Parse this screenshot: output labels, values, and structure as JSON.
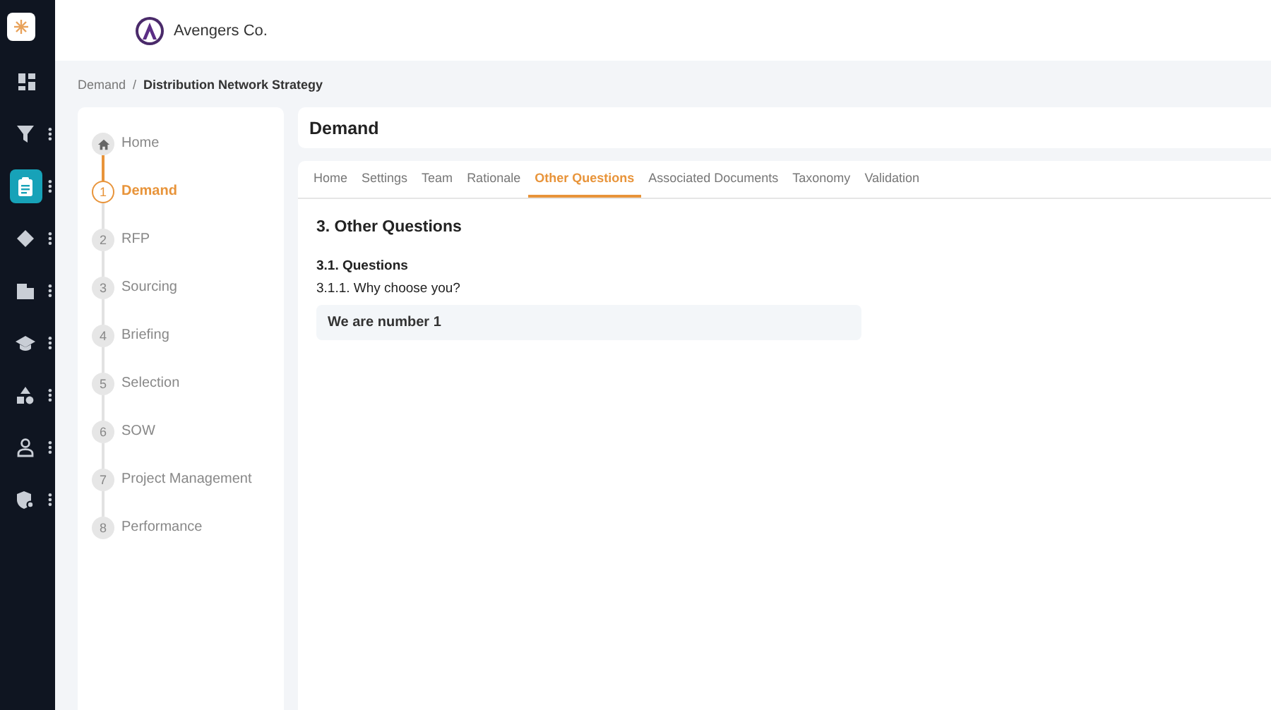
{
  "sidebar": {
    "items": [
      {
        "selected": false,
        "has_menu": false
      },
      {
        "selected": false,
        "has_menu": true
      },
      {
        "selected": true,
        "has_menu": true
      },
      {
        "selected": false,
        "has_menu": true
      },
      {
        "selected": false,
        "has_menu": true
      },
      {
        "selected": false,
        "has_menu": true
      },
      {
        "selected": false,
        "has_menu": true
      },
      {
        "selected": false,
        "has_menu": true
      },
      {
        "selected": false,
        "has_menu": true
      }
    ]
  },
  "header": {
    "company": "Avengers Co."
  },
  "breadcrumb": {
    "parent": "Demand",
    "separator": "/",
    "current": "Distribution Network Strategy"
  },
  "steps": [
    {
      "kind": "home",
      "label": "Home",
      "selected": false
    },
    {
      "kind": "numbered",
      "number": "1",
      "label": "Demand",
      "selected": true
    },
    {
      "kind": "numbered",
      "number": "2",
      "label": "RFP",
      "selected": false
    },
    {
      "kind": "numbered",
      "number": "3",
      "label": "Sourcing",
      "selected": false
    },
    {
      "kind": "numbered",
      "number": "4",
      "label": "Briefing",
      "selected": false
    },
    {
      "kind": "numbered",
      "number": "5",
      "label": "Selection",
      "selected": false
    },
    {
      "kind": "numbered",
      "number": "6",
      "label": "SOW",
      "selected": false
    },
    {
      "kind": "numbered",
      "number": "7",
      "label": "Project Management",
      "selected": false
    },
    {
      "kind": "numbered",
      "number": "8",
      "label": "Performance",
      "selected": false
    }
  ],
  "page_title": "Demand",
  "tabs": [
    {
      "label": "Home",
      "selected": false
    },
    {
      "label": "Settings",
      "selected": false
    },
    {
      "label": "Team",
      "selected": false
    },
    {
      "label": "Rationale",
      "selected": false
    },
    {
      "label": "Other Questions",
      "selected": true
    },
    {
      "label": "Associated Documents",
      "selected": false
    },
    {
      "label": "Taxonomy",
      "selected": false
    },
    {
      "label": "Validation",
      "selected": false
    }
  ],
  "section": {
    "title": "3. Other Questions",
    "subtitle": "3.1. Questions",
    "question": "3.1.1. Why choose you?",
    "answer": "We are number 1"
  }
}
